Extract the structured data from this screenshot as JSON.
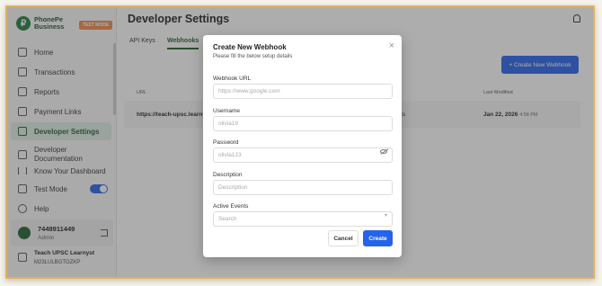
{
  "brand": {
    "name_line1": "PhonePe",
    "name_line2": "Business",
    "logo_glyph": "₽",
    "badge": "TEST MODE"
  },
  "sidebar": {
    "items": [
      {
        "label": "Home",
        "icon": "home-icon"
      },
      {
        "label": "Transactions",
        "icon": "transactions-icon"
      },
      {
        "label": "Reports",
        "icon": "reports-icon"
      },
      {
        "label": "Payment Links",
        "icon": "link-icon"
      },
      {
        "label": "Developer Settings",
        "icon": "code-icon",
        "active": true
      },
      {
        "label": "Developer Documentation",
        "icon": "document-icon"
      },
      {
        "label": "Know Your Dashboard",
        "icon": "dashboard-icon"
      }
    ],
    "test_mode_label": "Test Mode",
    "test_mode_on": true,
    "help_label": "Help",
    "user": {
      "phone": "7448911449",
      "role": "Admin"
    },
    "org": {
      "name": "Teach UPSC Learnyst",
      "id": "M23LULBGTOZKP"
    }
  },
  "main": {
    "title": "Developer Settings",
    "tabs": [
      {
        "label": "API Keys"
      },
      {
        "label": "Webhooks",
        "active": true
      }
    ],
    "create_button": "+ Create New Webhook",
    "table": {
      "headers": [
        "URL",
        "Last Modified"
      ],
      "row": {
        "url": "https://teach-upsc.learny",
        "events_tail": "ts",
        "date": "Jan 22, 2026",
        "time": "4:58 PM"
      }
    }
  },
  "modal": {
    "title": "Create New Webhook",
    "subtitle": "Please fill the below setup details",
    "fields": {
      "webhook_url": {
        "label": "Webhook URL",
        "placeholder": "https://www.google.com",
        "value": ""
      },
      "username": {
        "label": "Username",
        "placeholder": "olivia19",
        "value": ""
      },
      "password": {
        "label": "Password",
        "placeholder": "olivia123",
        "value": ""
      },
      "description": {
        "label": "Description",
        "placeholder": "Description",
        "value": ""
      },
      "active_events": {
        "label": "Active Events",
        "placeholder": "Search",
        "value": ""
      }
    },
    "cancel_label": "Cancel",
    "create_label": "Create",
    "close_glyph": "×"
  },
  "colors": {
    "accent": "#2563eb",
    "brand_green": "#1f5d2c",
    "badge_orange": "#f08a4b",
    "frame": "#e2b25a"
  }
}
